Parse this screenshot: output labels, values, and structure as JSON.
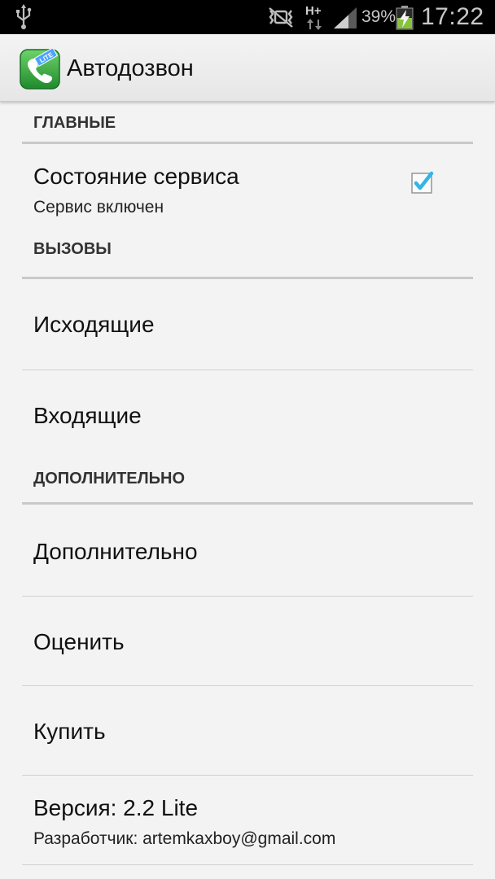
{
  "status_bar": {
    "network_type": "H+",
    "battery_percent": "39%",
    "time": "17:22",
    "icons": [
      "usb-icon",
      "mute-icon",
      "network-arrows-icon",
      "signal-icon",
      "battery-charging-icon"
    ]
  },
  "action_bar": {
    "title": "Автодозвон",
    "icon": "phone-app-icon",
    "icon_badge": "LITE"
  },
  "sections": {
    "main": {
      "header": "ГЛАВНЫЕ",
      "service": {
        "title": "Состояние сервиса",
        "summary": "Сервис включен",
        "checked": true
      }
    },
    "calls": {
      "header": "ВЫЗОВЫ",
      "outgoing": {
        "title": "Исходящие"
      },
      "incoming": {
        "title": "Входящие"
      }
    },
    "extra": {
      "header": "ДОПОЛНИТЕЛЬНО",
      "additional": {
        "title": "Дополнительно"
      },
      "rate": {
        "title": "Оценить"
      },
      "buy": {
        "title": "Купить"
      },
      "version": {
        "title": "Версия: 2.2 Lite",
        "summary": "Разработчик: artemkaxboy@gmail.com"
      }
    }
  },
  "colors": {
    "checkbox_check": "#33b5e5",
    "app_icon_green": "#2fae3a",
    "divider": "#c9c9c9"
  }
}
